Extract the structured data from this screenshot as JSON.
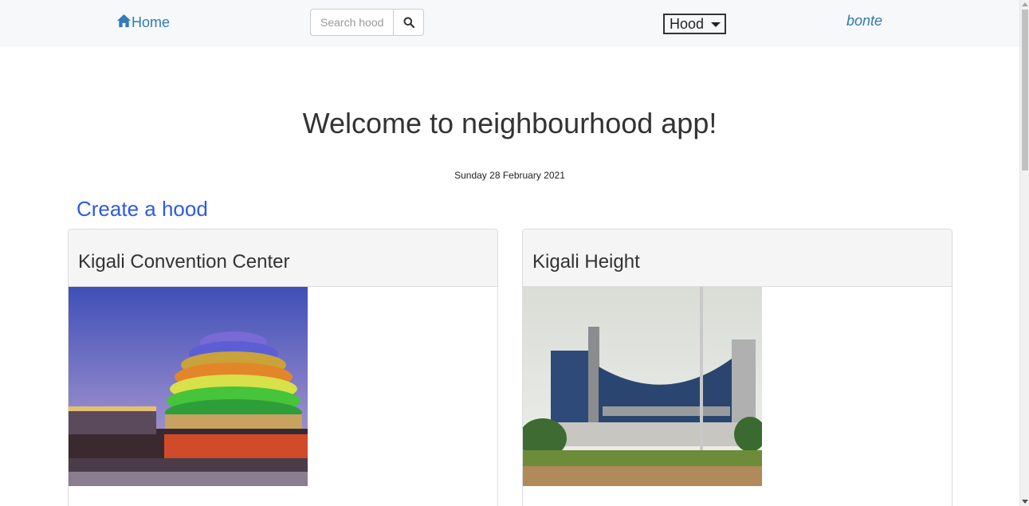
{
  "navbar": {
    "home_label": "Home",
    "home_icon": "home-icon",
    "search": {
      "placeholder": "Search hood",
      "value": ""
    },
    "search_icon": "search-icon",
    "hood_dropdown_label": "Hood",
    "user_name": "bonte"
  },
  "main": {
    "title": "Welcome to neighbourhood app!",
    "date": "Sunday 28 February 2021",
    "create_link": "Create a hood"
  },
  "hoods": [
    {
      "name": "Kigali Convention Center",
      "image": "convention-center-photo"
    },
    {
      "name": "Kigali Height",
      "image": "kigali-heights-photo"
    }
  ],
  "colors": {
    "link": "#337ab7",
    "create_link": "#2d5be3",
    "navbar_bg": "#f6f8fa",
    "card_header_bg": "#f5f5f5"
  }
}
